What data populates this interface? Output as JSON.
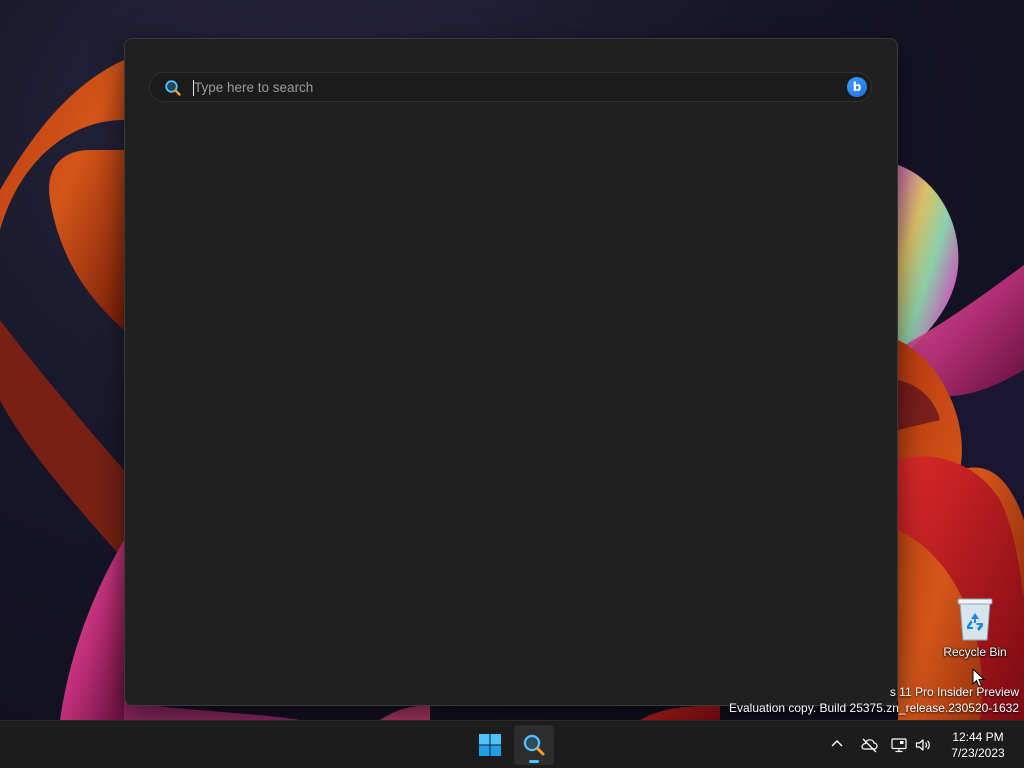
{
  "search": {
    "placeholder": "Type here to search",
    "bing_label": "b"
  },
  "desktop": {
    "recycle_bin_label": "Recycle Bin",
    "watermark_line1": "s 11 Pro Insider Preview",
    "watermark_line2": "Evaluation copy. Build 25375.zn_release.230520-1632"
  },
  "taskbar": {
    "start_icon": "windows-logo-icon",
    "search_icon": "search-icon",
    "tray_icons": [
      "chevron-up-icon",
      "network-disconnected-icon",
      "display-icon",
      "volume-icon"
    ],
    "time": "12:44 PM",
    "date": "7/23/2023"
  },
  "colors": {
    "panel_bg": "#202020",
    "taskbar_bg": "#1c1c1c",
    "accent": "#4cc2ff",
    "desktop_bg": "#171629"
  }
}
